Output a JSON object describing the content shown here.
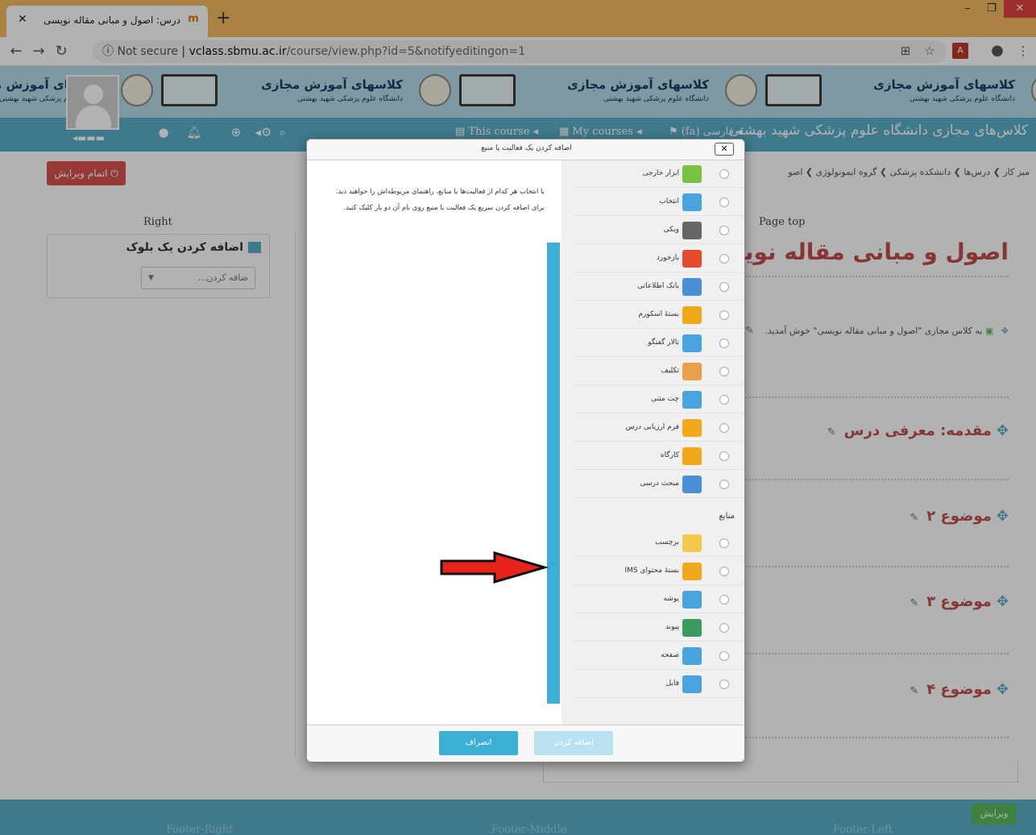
{
  "browser": {
    "tab_title": "درس: اصول و مبانی مقاله نویسی",
    "url_security": "Not secure",
    "url_domain": "vclass.sbmu.ac.ir",
    "url_path": "/course/view.php?id=5&notifyeditingon=1"
  },
  "banner": {
    "title": "کلاسهای آموزش مجازی",
    "subtitle": "دانشگاه علوم پزشکی شهید بهشتی"
  },
  "navbar": {
    "site_name": "کلاس‌های مجازی دانشگاه علوم پزشکی شهید بهشتی",
    "language": "فارسی (fa)",
    "my_courses": "My courses",
    "this_course": "This course"
  },
  "page": {
    "finish_editing": "اتمام ویرایش",
    "breadcrumb": "میز کار  ❯  درس‌ها  ❯  دانشکده پزشکی  ❯  گروه ایمونولوژی  ❯  اصو",
    "right_label": "Right",
    "add_block_title": "اضافه کردن یک بلوک",
    "add_block_select": "ضافه کردن...",
    "page_top_label": "Page top",
    "course_title": "اصول و مبانی مقاله نویسی",
    "welcome_text": "به کلاس مجازی \"اصول و مبانی مقاله نویسی\" خوش آمدید.",
    "sections": [
      "مقدمه: معرفی درس",
      "موضوع ۲",
      "موضوع ۳",
      "موضوع ۴"
    ]
  },
  "footer": {
    "right": "Footer-Right",
    "middle": "Footer-Middle",
    "left": "Footer-Left",
    "edit": "ویرایش"
  },
  "dialog": {
    "title": "اضافه کردن یک فعالیت یا منبع",
    "description": "با انتخاب هر کدام از فعالیت‌ها یا منابع، راهنمای مربوطه‌اش را خواهید دید. برای اضافه کردن سریع یک فعالیت یا منبع روی نام آن دو بار کلیک کنید.",
    "activities": [
      {
        "label": "ابزار خارجی",
        "icon": "puzzle-icon",
        "color": "#7cc242"
      },
      {
        "label": "انتخاب",
        "icon": "question-icon",
        "color": "#4aa3df"
      },
      {
        "label": "ویکی",
        "icon": "wiki-icon",
        "color": "#666666"
      },
      {
        "label": "بازخورد",
        "icon": "megaphone-icon",
        "color": "#e24a2c"
      },
      {
        "label": "بانک اطلاعاتی",
        "icon": "database-icon",
        "color": "#4a8fd8"
      },
      {
        "label": "بستهٔ اسکورم",
        "icon": "package-icon",
        "color": "#f2a81d"
      },
      {
        "label": "تالار گفتگو",
        "icon": "forum-icon",
        "color": "#4aa3df"
      },
      {
        "label": "تکلیف",
        "icon": "assignment-icon",
        "color": "#e8a04a"
      },
      {
        "label": "چت متنی",
        "icon": "chat-icon",
        "color": "#4aa3df"
      },
      {
        "label": "فرم ارزیابی درس",
        "icon": "survey-icon",
        "color": "#f2a81d"
      },
      {
        "label": "کارگاه",
        "icon": "workshop-icon",
        "color": "#f2a81d"
      },
      {
        "label": "مبحث درسی",
        "icon": "lesson-icon",
        "color": "#4a8fd8"
      }
    ],
    "resources_heading": "منابع",
    "resources": [
      {
        "label": "برچسب",
        "icon": "label-icon",
        "color": "#f2c94c"
      },
      {
        "label": "بستهٔ محتوای IMS",
        "icon": "ims-package-icon",
        "color": "#f2a81d"
      },
      {
        "label": "پوشه",
        "icon": "folder-icon",
        "color": "#4aa3df"
      },
      {
        "label": "پیوند",
        "icon": "url-icon",
        "color": "#3c9a5f"
      },
      {
        "label": "صفحه",
        "icon": "page-icon",
        "color": "#4aa3df"
      },
      {
        "label": "فایل",
        "icon": "file-icon",
        "color": "#4aa3df"
      }
    ],
    "add_button": "اضافه کردن",
    "cancel_button": "انصراف"
  }
}
